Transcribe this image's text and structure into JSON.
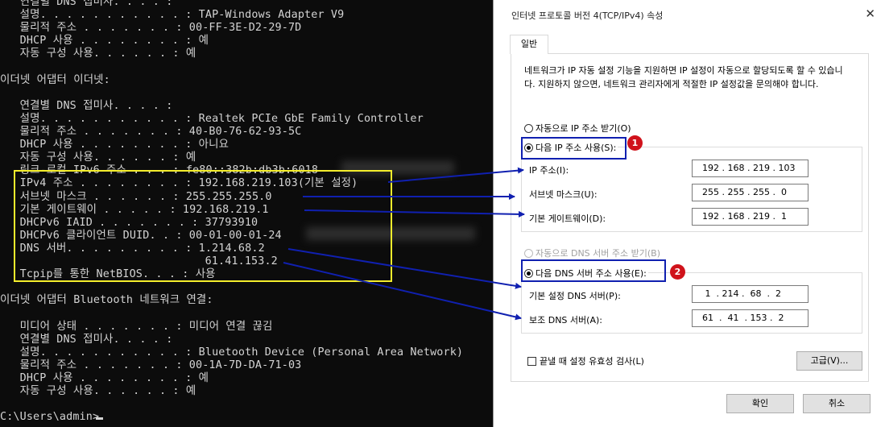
{
  "console": {
    "lines": [
      "   연결별 DNS 접미사. . . . :",
      "   설명. . . . . . . . . . . : TAP-Windows Adapter V9",
      "   물리적 주소 . . . . . . . : 00-FF-3E-D2-29-7D",
      "   DHCP 사용 . . . . . . . . : 예",
      "   자동 구성 사용. . . . . . : 예",
      "",
      "이더넷 어댑터 이더넷:",
      "",
      "   연결별 DNS 접미사. . . . :",
      "   설명. . . . . . . . . . . : Realtek PCIe GbE Family Controller",
      "   물리적 주소 . . . . . . . : 40-B0-76-62-93-5C",
      "   DHCP 사용 . . . . . . . . : 아니요",
      "   자동 구성 사용. . . . . . : 예",
      "   링크-로컬 IPv6 주소 . . . : fe80::382b:db3b:6018",
      "   IPv4 주소 . . . . . . . . : 192.168.219.103(기본 설정)",
      "   서브넷 마스크 . . . . . . : 255.255.255.0",
      "   기본 게이트웨이 . . . . . : 192.168.219.1",
      "   DHCPv6 IAID . . . . . . . : 37793910",
      "   DHCPv6 클라이언트 DUID. . : 00-01-00-01-24",
      "   DNS 서버. . . . . . . . . : 1.214.68.2",
      "                               61.41.153.2",
      "   Tcpip를 통한 NetBIOS. . . : 사용",
      "",
      "이더넷 어댑터 Bluetooth 네트워크 연결:",
      "",
      "   미디어 상태 . . . . . . . : 미디어 연결 끊김",
      "   연결별 DNS 접미사. . . . :",
      "   설명. . . . . . . . . . . : Bluetooth Device (Personal Area Network)",
      "   물리적 주소 . . . . . . . : 00-1A-7D-DA-71-03",
      "   DHCP 사용 . . . . . . . . : 예",
      "   자동 구성 사용. . . . . . : 예",
      "",
      "C:\\Users\\admin>"
    ]
  },
  "dialog": {
    "title": "인터넷 프로토콜 버전 4(TCP/IPv4) 속성",
    "close_glyph": "✕",
    "tab_label": "일반",
    "description": "네트워크가 IP 자동 설정 기능을 지원하면 IP 설정이 자동으로 할당되도록 할 수 있습니다. 지원하지 않으면, 네트워크 관리자에게 적절한 IP 설정값을 문의해야 합니다.",
    "radio_auto_ip": "자동으로 IP 주소 받기(O)",
    "radio_manual_ip": "다음 IP 주소 사용(S):",
    "ip_label": "IP 주소(I):",
    "ip_value": "192 . 168 . 219 . 103",
    "subnet_label": "서브넷 마스크(U):",
    "subnet_value": "255 . 255 . 255 .  0",
    "gateway_label": "기본 게이트웨이(D):",
    "gateway_value": "192 . 168 . 219 .  1",
    "radio_auto_dns": "자동으로 DNS 서버 주소 받기(B)",
    "radio_manual_dns": "다음 DNS 서버 주소 사용(E):",
    "dns1_label": "기본 설정 DNS 서버(P):",
    "dns1_value": " 1  . 214 .  68  .  2",
    "dns2_label": "보조 DNS 서버(A):",
    "dns2_value": "61  .  41  . 153 .  2",
    "validate_label": "끝낼 때 설정 유효성 검사(L)",
    "advanced_button": "고급(V)...",
    "ok_button": "확인",
    "cancel_button": "취소",
    "badge1": "1",
    "badge2": "2"
  },
  "colors": {
    "highlight_yellow": "#f4ee2c",
    "arrow_blue": "#1020b0",
    "badge_red": "#d0121b"
  }
}
